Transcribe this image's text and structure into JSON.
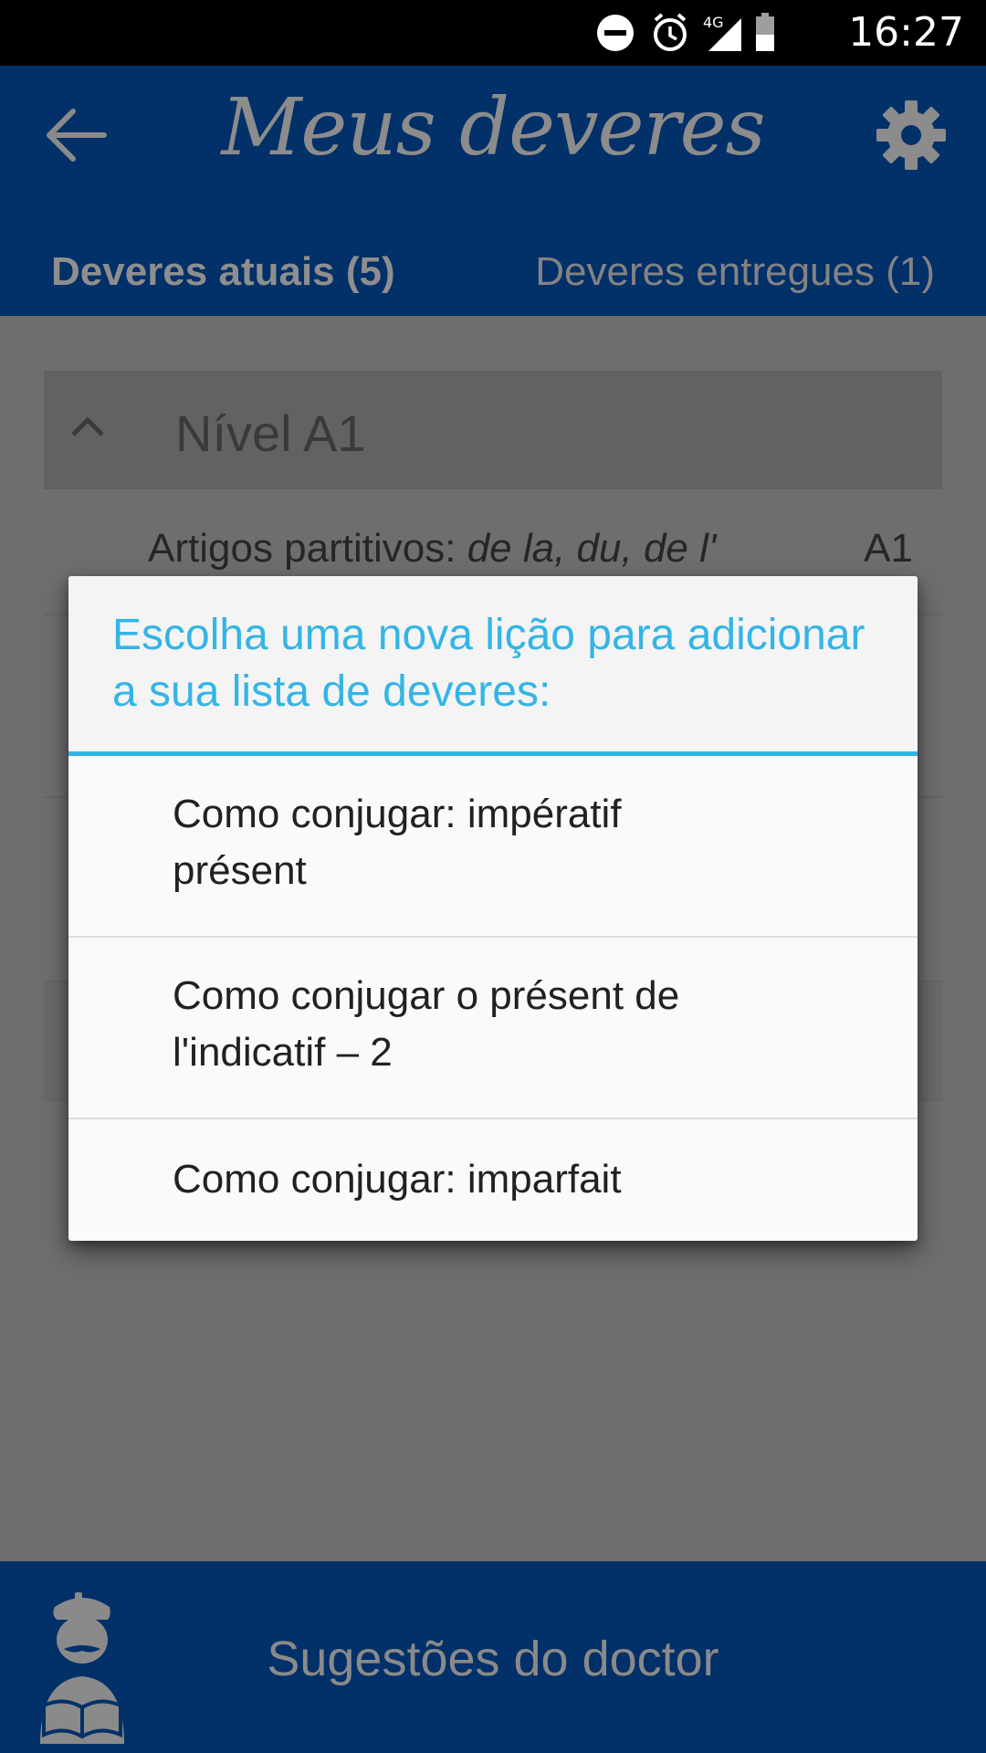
{
  "status_bar": {
    "time": "16:27",
    "network": "4G",
    "icons": [
      "do-not-disturb-icon",
      "alarm-icon",
      "signal-icon",
      "battery-icon"
    ]
  },
  "app_bar": {
    "title": "Meus deveres",
    "tabs": [
      {
        "label": "Deveres atuais (5)",
        "selected": true
      },
      {
        "label": "Deveres entregues (1)",
        "selected": false
      }
    ]
  },
  "content": {
    "level_header": "Nível A1",
    "first_lesson": {
      "prefix": "Artigos partitivos: ",
      "italic": "de la, du, de l'",
      "level": "A1"
    }
  },
  "dialog": {
    "title": "Escolha uma nova lição para adicionar a sua lista de deveres:",
    "options": [
      "Como conjugar: impératif présent",
      "Como conjugar o présent de l'indicatif – 2",
      "Como conjugar: imparfait"
    ]
  },
  "bottom_bar": {
    "label": "Sugestões do doctor"
  },
  "colors": {
    "app_bar": "#023069",
    "dialog_accent": "#33b5e5",
    "overlay_bg": "#6e6e6e"
  }
}
